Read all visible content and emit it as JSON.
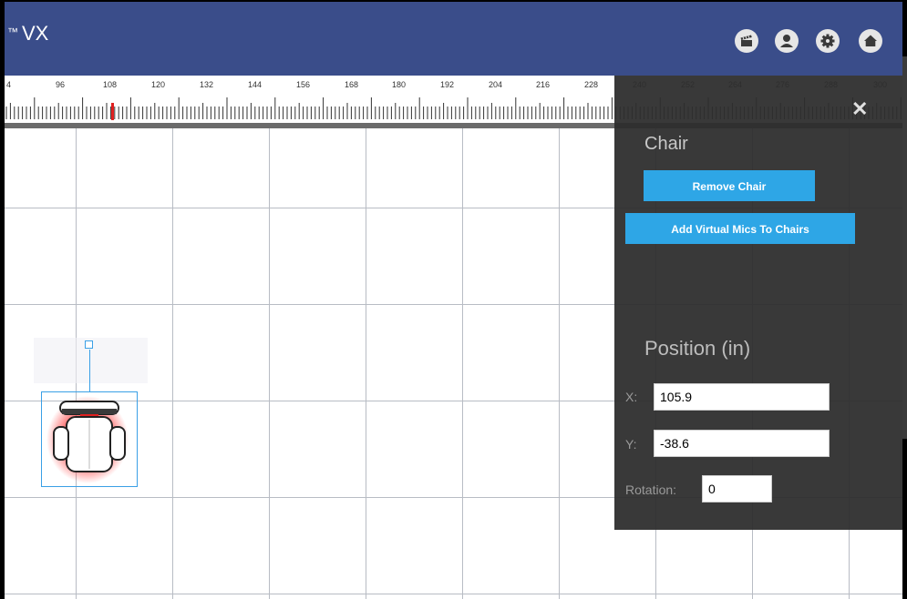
{
  "header": {
    "title_prefix": "™",
    "title": "VX",
    "icons": [
      "clapperboard-icon",
      "user-icon",
      "gear-icon",
      "home-icon"
    ]
  },
  "ruler": {
    "labels": [
      "4",
      "96",
      "108",
      "120",
      "132",
      "144",
      "156",
      "168",
      "180",
      "192",
      "204",
      "216",
      "228",
      "240",
      "252",
      "264",
      "276",
      "288",
      "300"
    ]
  },
  "panel": {
    "section_title": "Chair",
    "remove_button": "Remove Chair",
    "add_mics_button": "Add Virtual Mics To Chairs",
    "position_title": "Position (in)",
    "x_label": "X:",
    "x_value": "105.9",
    "y_label": "Y:",
    "y_value": "-38.6",
    "rotation_label": "Rotation:",
    "rotation_value": "0",
    "close_symbol": "✕"
  },
  "colors": {
    "header_bg": "#3a4d8a",
    "button_bg": "#2ea6e6",
    "selection": "#3aa0e6",
    "ruler_marker": "#e02020"
  }
}
